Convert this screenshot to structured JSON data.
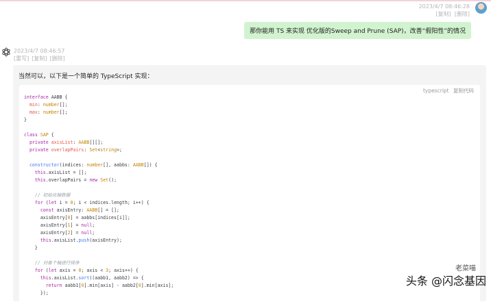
{
  "user_message": {
    "timestamp": "2023/4/7 08:46:28",
    "actions": [
      "[复制]",
      "[删除]"
    ],
    "text": "那你能用 TS 来实现 优化版的Sweep and Prune (SAP)，改善“假阳性”的情况"
  },
  "bot_message": {
    "timestamp": "2023/4/7 08:46:57",
    "actions": [
      "[重写]",
      "[复制]",
      "[删除]"
    ],
    "intro": "当然可以，以下是一个简单的 TypeScript 实现：",
    "code_language": "typescript",
    "copy_code_label": "复制代码"
  },
  "watermark": {
    "text": "头条 @闪念基因",
    "sub": "老菜喵"
  },
  "colors": {
    "user_bubble": "#d2f3d0",
    "bot_bubble": "#f4f4f4",
    "keyword": "#a626a4",
    "type": "#c18401",
    "variable": "#e45649",
    "function": "#4078f2"
  },
  "icons": [
    "user-avatar-icon",
    "openai-logo-icon"
  ]
}
